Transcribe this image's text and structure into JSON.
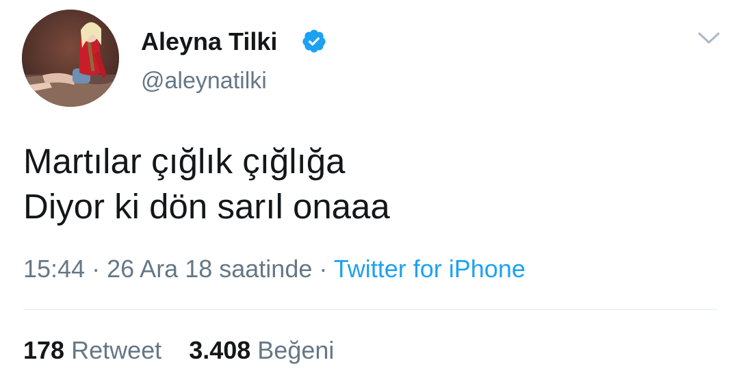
{
  "user": {
    "display_name": "Aleyna Tilki",
    "handle": "@aleynatilki",
    "verified_icon": "verified-badge-icon",
    "avatar_icon": "profile-photo"
  },
  "tweet": {
    "lines": [
      "Martılar çığlık çığlığa",
      "Diyor ki dön sarıl onaaa"
    ],
    "time": "15:44",
    "separator": "·",
    "date": "26 Ara 18 saatinde",
    "source": "Twitter for iPhone"
  },
  "stats": {
    "retweets_count": "178",
    "retweets_label": "Retweet",
    "likes_count": "3.408",
    "likes_label": "Beğeni"
  },
  "menu_icon": "chevron-down-icon",
  "colors": {
    "text": "#14171a",
    "secondary": "#657786",
    "link": "#1da1f2",
    "divider": "#e1e8ed",
    "verified": "#1da1f2"
  }
}
